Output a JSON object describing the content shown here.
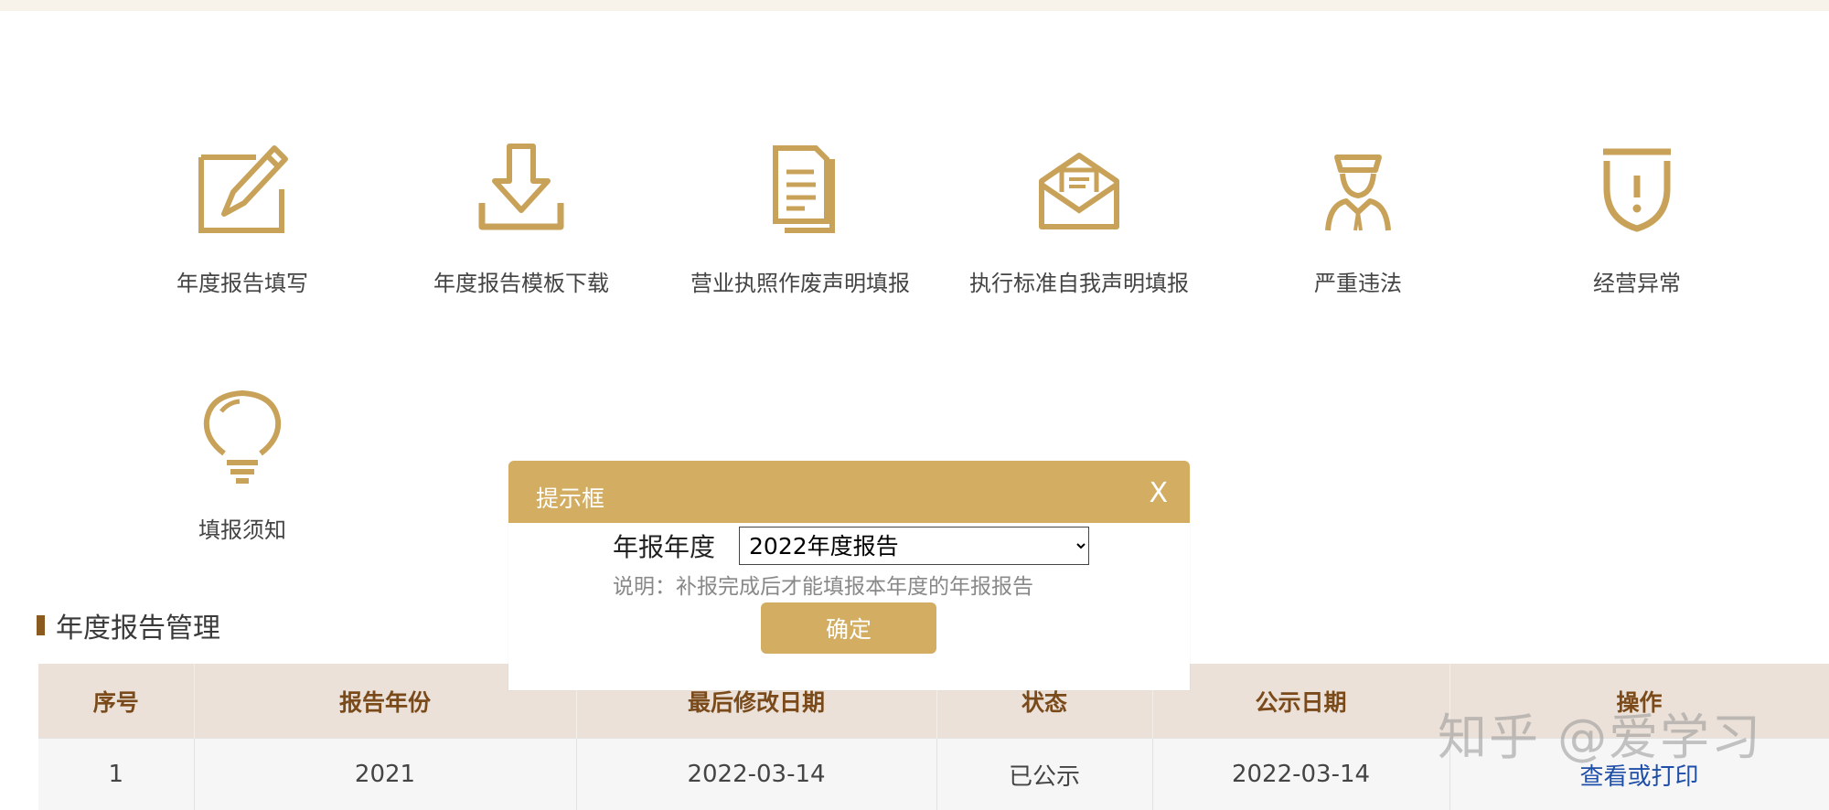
{
  "accent_color": "#c9a25a",
  "tiles": [
    {
      "label": "年度报告填写",
      "icon": "edit-icon"
    },
    {
      "label": "年度报告模板下载",
      "icon": "download-icon"
    },
    {
      "label": "营业执照作废声明填报",
      "icon": "document-icon"
    },
    {
      "label": "执行标准自我声明填报",
      "icon": "envelope-icon"
    },
    {
      "label": "严重违法",
      "icon": "officer-icon"
    },
    {
      "label": "经营异常",
      "icon": "warning-shield-icon"
    },
    {
      "label": "填报须知",
      "icon": "lightbulb-icon"
    }
  ],
  "section": {
    "title": "年度报告管理"
  },
  "table": {
    "headers": [
      "序号",
      "报告年份",
      "最后修改日期",
      "状态",
      "公示日期",
      "操作"
    ],
    "rows": [
      [
        "1",
        "2021",
        "2022-03-14",
        "已公示",
        "2022-03-14",
        "查看或打印"
      ]
    ]
  },
  "dialog": {
    "title": "提示框",
    "close": "X",
    "field_label": "年报年度",
    "selected": "2022年度报告",
    "note": "说明：补报完成后才能填报本年度的年报报告",
    "ok": "确定"
  },
  "watermark": "知乎 @爱学习"
}
